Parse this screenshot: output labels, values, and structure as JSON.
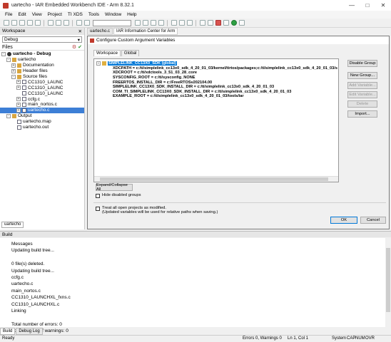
{
  "window": {
    "title": "uartecho - IAR Embedded Workbench IDE - Arm 8.32.1",
    "controls": [
      "minimize-icon",
      "maximize-icon",
      "close-icon"
    ]
  },
  "menu": [
    "File",
    "Edit",
    "View",
    "Project",
    "TI XDS",
    "Tools",
    "Window",
    "Help"
  ],
  "workspace": {
    "title": "Workspace",
    "config": "Debug",
    "files_header": "Files",
    "tree": [
      {
        "label": "uartecho - Debug",
        "level": 0,
        "kind": "proj",
        "exp": "-",
        "bold": true
      },
      {
        "label": "uartecho",
        "level": 1,
        "kind": "folder",
        "exp": "-"
      },
      {
        "label": "Documentation",
        "level": 2,
        "kind": "folder",
        "exp": "+"
      },
      {
        "label": "Header files",
        "level": 2,
        "kind": "folder",
        "exp": "+"
      },
      {
        "label": "Source files",
        "level": 2,
        "kind": "folder",
        "exp": "-"
      },
      {
        "label": "CC1310_LAUNC",
        "level": 3,
        "kind": "file",
        "exp": "+"
      },
      {
        "label": "CC1310_LAUNC",
        "level": 3,
        "kind": "file",
        "exp": "+"
      },
      {
        "label": "CC1310_LAUNC",
        "level": 3,
        "kind": "file",
        "exp": ""
      },
      {
        "label": "ccfg.c",
        "level": 3,
        "kind": "file",
        "exp": "+"
      },
      {
        "label": "main_nortos.c",
        "level": 3,
        "kind": "file",
        "exp": "+"
      },
      {
        "label": "uartecho.c",
        "level": 3,
        "kind": "file",
        "exp": "+",
        "selected": true
      },
      {
        "label": "Output",
        "level": 1,
        "kind": "folder",
        "exp": "-"
      },
      {
        "label": "uartecho.map",
        "level": 2,
        "kind": "file",
        "exp": ""
      },
      {
        "label": "uartecho.out",
        "level": 2,
        "kind": "file",
        "exp": ""
      }
    ],
    "bottom_tab": "uartecho"
  },
  "editor_tabs": [
    "uartecho.c",
    "IAR Information Center for Arm"
  ],
  "dialog": {
    "title": "Configure Custom Argument Variables",
    "tabs": [
      "Workspace",
      "Global"
    ],
    "group_label": "SIMPLELINK_CC13X0_SDK (global)",
    "variables": [
      "XDCPATH = c:/ti/simplelink_cc13x0_sdk_4_20_01_03/kernel/tirtos/packages;c:/ti/simplelink_cc13x0_sdk_4_20_01_03/s",
      "XDCROOT = c:/ti/xdctools_3_51_03_28_core",
      "SYSCONFIG_ROOT = c:/ti/sysconfig_NONE",
      "FREERTOS_INSTALL_DIR = c:/FreeRTOSv202104.00",
      "SIMPLELINK_CC13X0_SDK_INSTALL_DIR = c:/ti/simplelink_cc13x0_sdk_4_20_01_03",
      "COM_TI_SIMPLELINK_CC13X0_SDK_INSTALL_DIR = c:/ti/simplelink_cc13x0_sdk_4_20_01_03",
      "EXAMPLE_ROOT = c:/ti/simplelink_cc13x0_sdk_4_20_01_03/tools/iar"
    ],
    "buttons": {
      "disable_group": "Disable Group",
      "new_group": "New Group...",
      "add_variable": "Add Variable...",
      "edit_variable": "Edit Variable...",
      "delete": "Delete",
      "import": "Import...",
      "expand_collapse": "Expand/Collapse All",
      "ok": "OK",
      "cancel": "Cancel"
    },
    "hide_disabled": "Hide disabled groups",
    "treat_all_line1": "Treat all open projects as modified.",
    "treat_all_line2": "(Updated variables will be used for relative paths when saving.)"
  },
  "build": {
    "title": "Build",
    "messages": [
      "Messages",
      "Updating build tree...",
      "",
      "0 file(s) deleted.",
      "Updating build tree...",
      "ccfg.c",
      "uartecho.c",
      "main_nortos.c",
      "CC1310_LAUNCHXL_fxns.c",
      "CC1310_LAUNCHXL.c",
      "Linking",
      "",
      "Total number of errors: 0",
      "Total number of warnings: 0"
    ],
    "tabs": [
      "Build",
      "Debug Log"
    ]
  },
  "status": {
    "left": "Ready",
    "errors": "Errors 0, Warnings 0",
    "position": "Ln 1, Col 1",
    "system": "System",
    "caps": "CAP",
    "num": "NUM",
    "ovr": "OVR"
  }
}
